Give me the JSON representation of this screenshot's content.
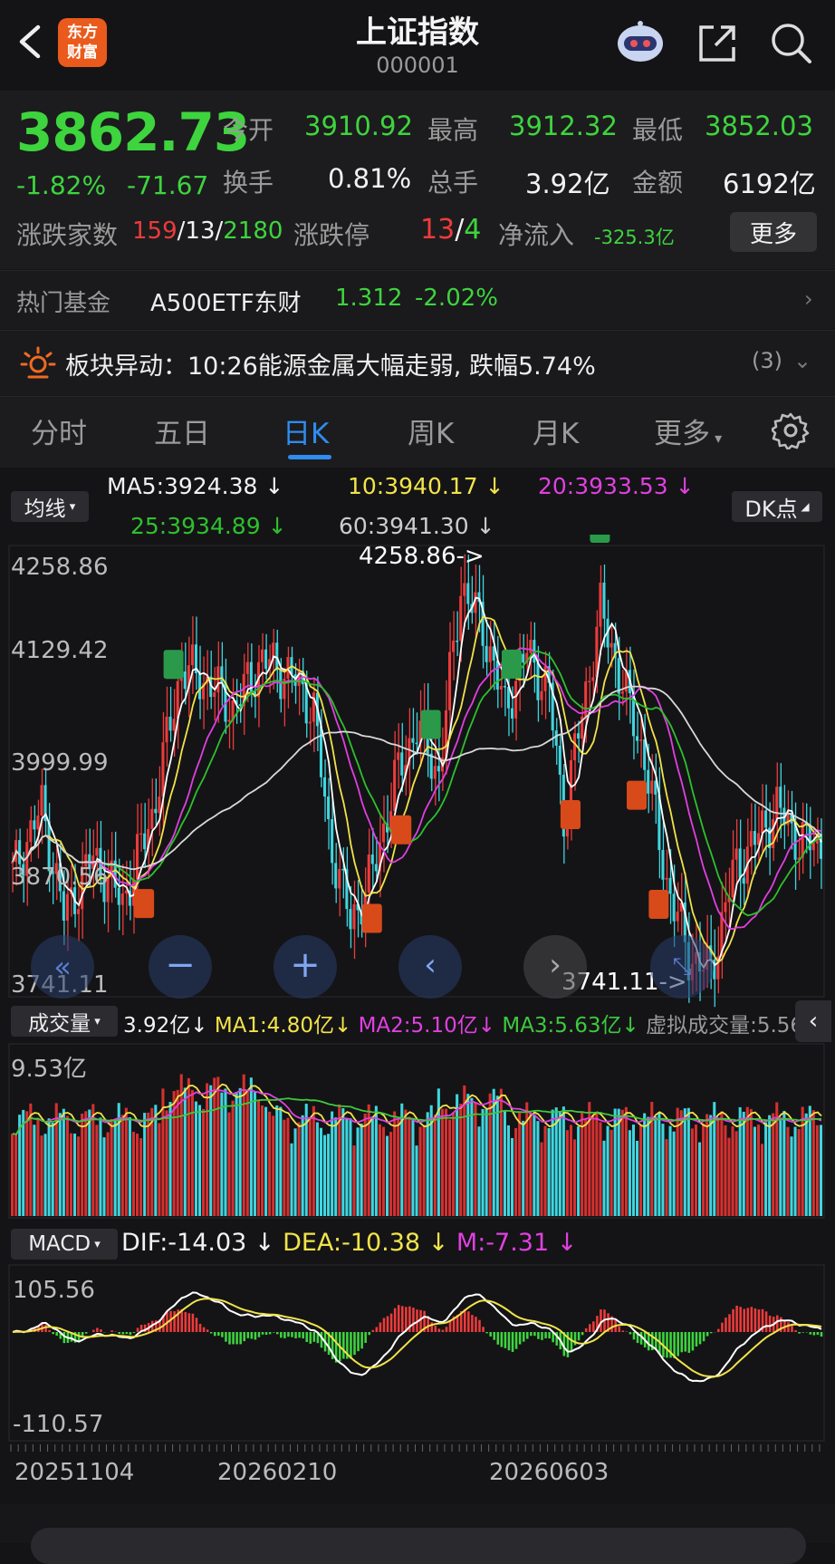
{
  "header": {
    "title": "上证指数",
    "code": "000001",
    "logo_line1": "东方",
    "logo_line2": "财富"
  },
  "quote": {
    "price": "3862.73",
    "pct": "-1.82%",
    "chg": "-71.67",
    "open_label": "今开",
    "open": "3910.92",
    "high_label": "最高",
    "high": "3912.32",
    "low_label": "最低",
    "low": "3852.03",
    "turnover_label": "换手",
    "turnover": "0.81%",
    "volume_label": "总手",
    "volume": "3.92亿",
    "amount_label": "金额",
    "amount": "6192亿",
    "updown_label": "涨跌家数",
    "up": "159",
    "flat": "13",
    "down": "2180",
    "limit_label": "涨跌停",
    "limit_up": "13",
    "limit_down": "4",
    "flow_label": "净流入",
    "flow": "-325.3亿",
    "more": "更多"
  },
  "fund": {
    "label": "热门基金",
    "name": "A500ETF东财",
    "price": "1.312",
    "pct": "-2.02%"
  },
  "alert": {
    "text": "板块异动：10:26能源金属大幅走弱, 跌幅5.74%",
    "count": "(3)"
  },
  "tabs": [
    {
      "label": "分时"
    },
    {
      "label": "五日"
    },
    {
      "label": "日K"
    },
    {
      "label": "周K"
    },
    {
      "label": "月K"
    },
    {
      "label": "更多"
    }
  ],
  "ma_legend": {
    "chip": "均线",
    "ma5": "MA5:3924.38",
    "ma10": "10:3940.17",
    "ma20": "20:3933.53",
    "ma25": "25:3934.89",
    "ma60": "60:3941.30",
    "dk": "DK点"
  },
  "kline": {
    "y_labels": [
      "4258.86",
      "4129.42",
      "3999.99",
      "3870.56",
      "3741.11"
    ],
    "high_marker": "4258.86->",
    "low_marker": "3741.11->"
  },
  "volume": {
    "chip": "成交量",
    "value": "3.92亿",
    "ma1": "MA1:4.80亿",
    "ma2": "MA2:5.10亿",
    "ma3": "MA3:5.63亿",
    "virtual": "虚拟成交量:5.56亿",
    "max_label": "9.53亿"
  },
  "macd": {
    "chip": "MACD",
    "dif": "DIF:-14.03",
    "dea": "DEA:-10.38",
    "m": "M:-7.31",
    "top": "105.56",
    "bottom": "-110.57"
  },
  "dates": [
    "20251104",
    "20260210",
    "20260603"
  ],
  "colors": {
    "up": "#ee3b3b",
    "down": "#3ed43e",
    "ma5": "#ffffff",
    "ma10": "#f2e34a",
    "ma20": "#e040e0",
    "ma25": "#2ec02e",
    "ma60": "#d8d8d8",
    "vol_up": "#d63030",
    "vol_down": "#3fd6e0",
    "accent": "#2f8cf0"
  }
}
